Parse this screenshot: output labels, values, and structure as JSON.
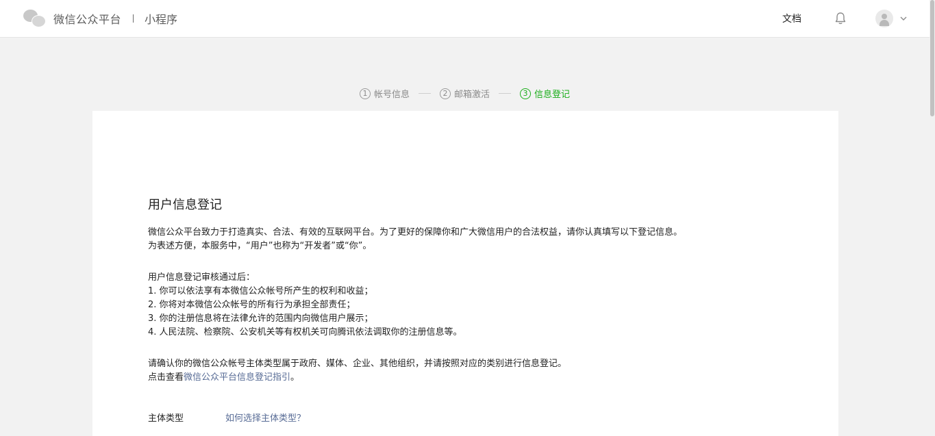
{
  "header": {
    "brand_name": "微信公众平台",
    "brand_sub": "小程序",
    "doc_label": "文档"
  },
  "steps": [
    {
      "num": "1",
      "label": "帐号信息",
      "active": false
    },
    {
      "num": "2",
      "label": "邮箱激活",
      "active": false
    },
    {
      "num": "3",
      "label": "信息登记",
      "active": true
    }
  ],
  "main": {
    "title": "用户信息登记",
    "intro": [
      "微信公众平台致力于打造真实、合法、有效的互联网平台。为了更好的保障你和广大微信用户的合法权益，请你认真填写以下登记信息。",
      "为表述方便，本服务中，“用户”也称为“开发者”或“你”。"
    ],
    "after_review": [
      "用户信息登记审核通过后：",
      "1. 你可以依法享有本微信公众帐号所产生的权利和收益；",
      "2. 你将对本微信公众帐号的所有行为承担全部责任；",
      "3. 你的注册信息将在法律允许的范围内向微信用户展示；",
      "4. 人民法院、检察院、公安机关等有权机关可向腾讯依法调取你的注册信息等。"
    ],
    "confirm": "请确认你的微信公众帐号主体类型属于政府、媒体、企业、其他组织，并请按照对应的类别进行信息登记。",
    "guide_prefix": "点击查看",
    "guide_link": "微信公众平台信息登记指引",
    "guide_suffix": "。",
    "subject_label": "主体类型",
    "subject_help_link": "如何选择主体类型？"
  },
  "colors": {
    "accent": "#1aad19",
    "link": "#576b95"
  },
  "icons": {
    "logo": "wechat-logo-icon",
    "bell": "bell-icon",
    "avatar": "avatar-icon",
    "dropdown": "chevron-down-icon"
  }
}
